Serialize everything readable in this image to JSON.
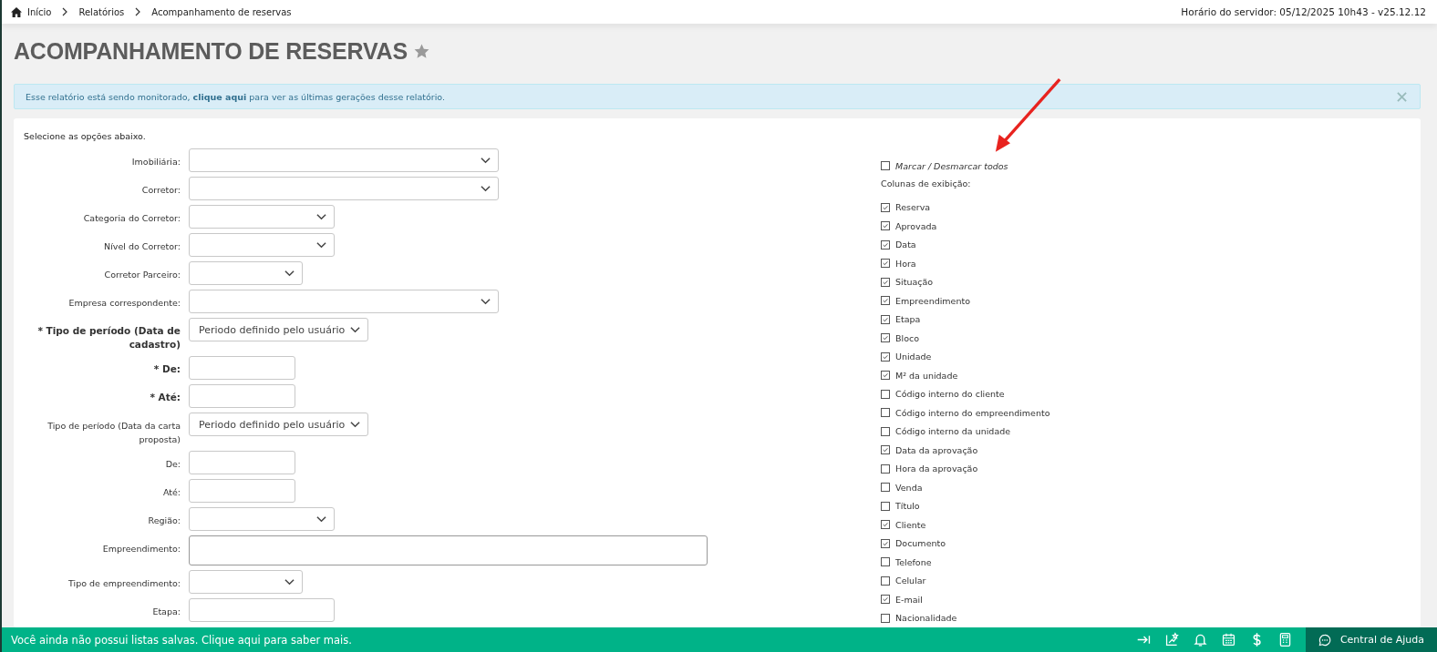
{
  "breadcrumb": [
    "Início",
    "Relatórios",
    "Acompanhamento de reservas"
  ],
  "server_time": "Horário do servidor: 05/12/2025 10h43 - v25.12.12",
  "title": "ACOMPANHAMENTO DE RESERVAS",
  "favorite": false,
  "alert": {
    "text": "Esse relatório está sendo monitorado, **clique aqui** para ver as últimas gerações desse relatório."
  },
  "instructions": "Selecione as opções abaixo.",
  "fields": [
    {
      "label": "Imobiliária:",
      "kind": "select",
      "required": false
    },
    {
      "label": "Corretor:",
      "kind": "select",
      "required": false
    },
    {
      "label": "Categoria do Corretor:",
      "kind": "select",
      "required": false
    },
    {
      "label": "Nível do Corretor:",
      "kind": "select",
      "required": false
    },
    {
      "label": "Corretor Parceiro:",
      "kind": "select",
      "required": false
    },
    {
      "label": "Empresa correspondente:",
      "kind": "select",
      "required": false
    },
    {
      "label": "* Tipo de período (Data de cadastro)",
      "kind": "select",
      "required": true,
      "value": "Periodo definido pelo usuário"
    },
    {
      "label": "* De:",
      "kind": "input",
      "required": true
    },
    {
      "label": "* Até:",
      "kind": "input",
      "required": true
    },
    {
      "label": "Tipo de período (Data da carta proposta)",
      "kind": "select",
      "required": false,
      "value": "Periodo definido pelo usuário"
    },
    {
      "label": "De:",
      "kind": "input",
      "required": false
    },
    {
      "label": "Até:",
      "kind": "input",
      "required": false
    },
    {
      "label": "Região:",
      "kind": "select",
      "required": false
    },
    {
      "label": "Empreendimento:",
      "kind": "textarea",
      "required": false
    },
    {
      "label": "Tipo de empreendimento:",
      "kind": "select",
      "required": false
    },
    {
      "label": "Etapa:",
      "kind": "input",
      "required": false
    }
  ],
  "toggle_all": {
    "label": "Marcar / Desmarcar todos",
    "checked": false
  },
  "columns_heading": "Colunas de exibição:",
  "columns": [
    {
      "label": "Reserva",
      "checked": true
    },
    {
      "label": "Aprovada",
      "checked": true
    },
    {
      "label": "Data",
      "checked": true
    },
    {
      "label": "Hora",
      "checked": true
    },
    {
      "label": "Situação",
      "checked": true
    },
    {
      "label": "Empreendimento",
      "checked": true
    },
    {
      "label": "Etapa",
      "checked": true
    },
    {
      "label": "Bloco",
      "checked": true
    },
    {
      "label": "Unidade",
      "checked": true
    },
    {
      "label": "M² da unidade",
      "checked": true
    },
    {
      "label": "Código interno do cliente",
      "checked": false
    },
    {
      "label": "Código interno do empreendimento",
      "checked": false
    },
    {
      "label": "Código interno da unidade",
      "checked": false
    },
    {
      "label": "Data da aprovação",
      "checked": true
    },
    {
      "label": "Hora da aprovação",
      "checked": false
    },
    {
      "label": "Venda",
      "checked": false
    },
    {
      "label": "Título",
      "checked": false
    },
    {
      "label": "Cliente",
      "checked": true
    },
    {
      "label": "Documento",
      "checked": true
    },
    {
      "label": "Telefone",
      "checked": false
    },
    {
      "label": "Celular",
      "checked": false
    },
    {
      "label": "E-mail",
      "checked": true
    },
    {
      "label": "Nacionalidade",
      "checked": false
    }
  ],
  "footer": {
    "message": "Você ainda não possui listas salvas. Clique aqui para saber mais.",
    "help": "Central de Ajuda"
  }
}
